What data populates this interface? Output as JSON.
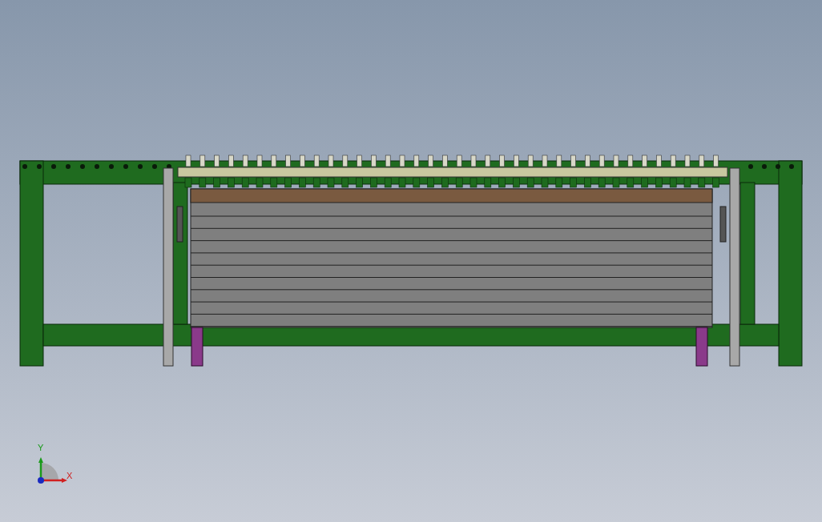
{
  "axis_triad": {
    "y_label": "Y",
    "x_label": "X"
  }
}
